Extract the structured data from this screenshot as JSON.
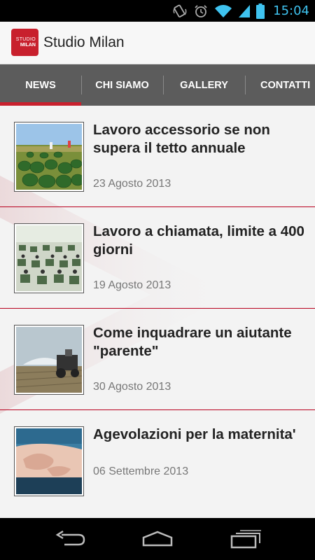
{
  "status_bar": {
    "time": "15:04",
    "icons": [
      "rotate-icon",
      "alarm-icon",
      "wifi-icon",
      "signal-icon",
      "battery-icon"
    ]
  },
  "app": {
    "title": "Studio Milan",
    "logo_line1": "STUDIO",
    "logo_line2": "MILAN"
  },
  "tabs": [
    {
      "label": "NEWS",
      "active": true
    },
    {
      "label": "CHI SIAMO",
      "active": false
    },
    {
      "label": "GALLERY",
      "active": false
    },
    {
      "label": "CONTATTI",
      "active": false
    }
  ],
  "news": [
    {
      "title": "Lavoro accessorio se non supera il tetto annuale",
      "date": "23 Agosto 2013",
      "thumb": "watermelon-field"
    },
    {
      "title": "Lavoro a chiamata, limite a 400 giorni",
      "date": "19 Agosto 2013",
      "thumb": "office-workers"
    },
    {
      "title": "Come inquadrare un aiutante \"parente\"",
      "date": "30 Agosto 2013",
      "thumb": "farm-irrigation"
    },
    {
      "title": "Agevolazioni per la maternita'",
      "date": "06 Settembre 2013",
      "thumb": "pregnant-belly"
    }
  ],
  "nav": {
    "icons": [
      "back-icon",
      "home-icon",
      "recent-apps-icon"
    ]
  },
  "colors": {
    "accent": "#c8202d",
    "tab_bar": "#5c5c5c",
    "status_icon": "#3fc3f0"
  }
}
